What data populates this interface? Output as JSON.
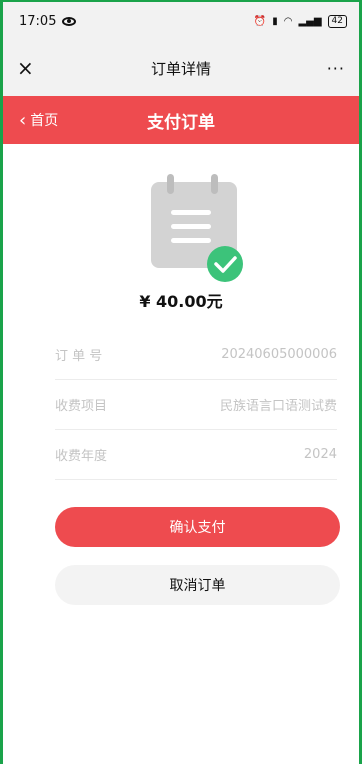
{
  "status_bar": {
    "time": "17:05",
    "battery": "42"
  },
  "title_bar": {
    "close": "×",
    "title": "订单详情",
    "more": "···"
  },
  "red_header": {
    "back_label": "首页",
    "title": "支付订单"
  },
  "order": {
    "amount": "¥ 40.00元",
    "rows": [
      {
        "label": "订 单 号",
        "value": "20240605000006"
      },
      {
        "label": "收费项目",
        "value": "民族语言口语测试费"
      },
      {
        "label": "收费年度",
        "value": "2024"
      }
    ]
  },
  "buttons": {
    "confirm": "确认支付",
    "cancel": "取消订单"
  },
  "colors": {
    "accent": "#ee4b4f",
    "check": "#3cc37a",
    "frame": "#1aa34a"
  }
}
